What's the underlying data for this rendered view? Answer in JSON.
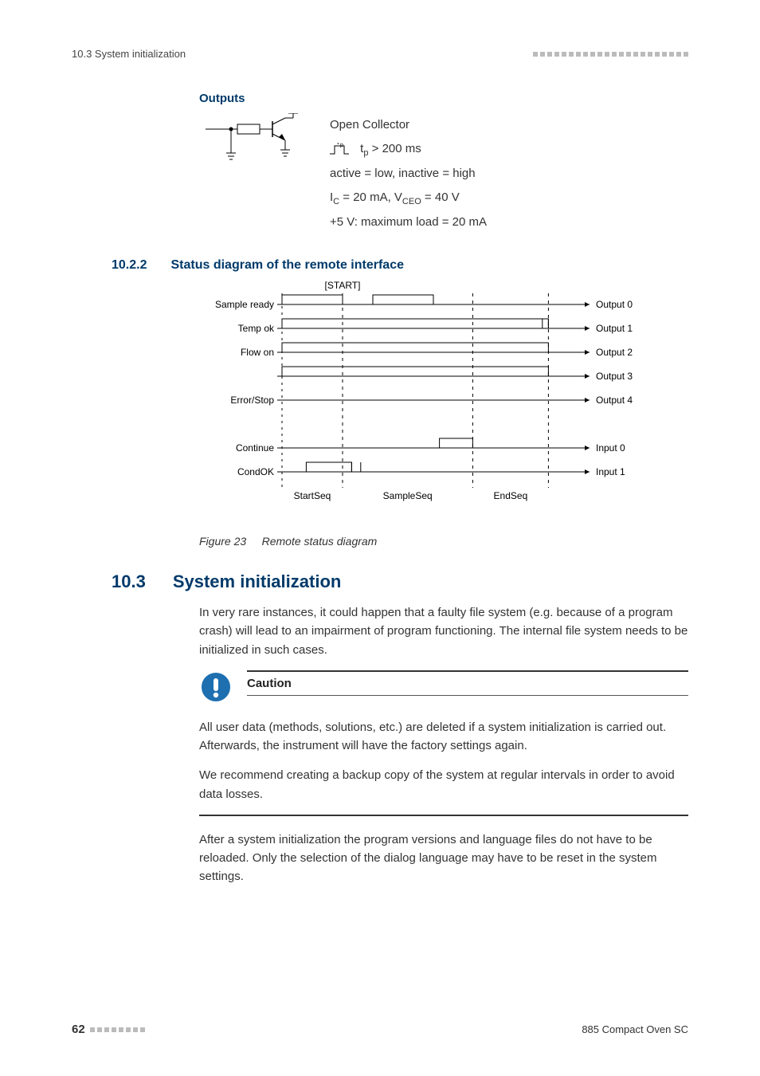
{
  "header": {
    "running": "10.3 System initialization"
  },
  "outputs": {
    "heading": "Outputs",
    "line1": "Open Collector",
    "tp_label": "t",
    "tp_sub": "p",
    "tp_expr": " > 200 ms",
    "active_line": "active = low, inactive = high",
    "ic_line_pre": "I",
    "ic_sub": "C",
    "ic_mid": " = 20 mA, V",
    "vceo_sub": "CEO",
    "ic_post": " = 40 V",
    "last_line": "+5 V: maximum load = 20 mA"
  },
  "sec1022": {
    "num": "10.2.2",
    "title": "Status diagram of the remote interface"
  },
  "chart_data": {
    "type": "timing-diagram",
    "title": "Remote status diagram",
    "phases": [
      "StartSeq",
      "SampleSeq",
      "EndSeq"
    ],
    "phase_bounds": [
      0.0,
      0.2,
      0.63,
      0.88
    ],
    "start_marker": "[START]",
    "rows": [
      {
        "left_label": "Sample ready",
        "right_label": "Output 0",
        "segments": [
          [
            0.0,
            0.2
          ],
          [
            0.3,
            0.5
          ]
        ]
      },
      {
        "left_label": "Temp ok",
        "right_label": "Output 1",
        "segments": [
          [
            0.0,
            0.88
          ]
        ],
        "dip": [
          0.86,
          0.88
        ]
      },
      {
        "left_label": "Flow on",
        "right_label": "Output 2",
        "segments": [
          [
            0.0,
            0.88
          ]
        ]
      },
      {
        "left_label": "",
        "right_label": "Output 3",
        "segments": [
          [
            0.0,
            0.88
          ]
        ]
      },
      {
        "left_label": "Error/Stop",
        "right_label": "Output 4",
        "segments": []
      },
      {
        "spacer": true
      },
      {
        "left_label": "Continue",
        "right_label": "Input 0",
        "segments": [
          [
            0.52,
            0.63
          ]
        ]
      },
      {
        "left_label": "CondOK",
        "right_label": "Input 1",
        "segments": [
          [
            0.08,
            0.23
          ]
        ],
        "dip": [
          0.23,
          0.26
        ]
      }
    ],
    "figure_number": "Figure 23",
    "figure_caption": "Remote status diagram"
  },
  "sec103": {
    "num": "10.3",
    "title": "System initialization",
    "para1": "In very rare instances, it could happen that a faulty file system (e.g. because of a program crash) will lead to an impairment of program functioning. The internal file system needs to be initialized in such cases.",
    "caution_label": "Caution",
    "caution_p1": "All user data (methods, solutions, etc.) are deleted if a system initialization is carried out. Afterwards, the instrument will have the factory settings again.",
    "caution_p2": "We recommend creating a backup copy of the system at regular intervals in order to avoid data losses.",
    "para2": "After a system initialization the program versions and language files do not have to be reloaded. Only the selection of the dialog language may have to be reset in the system settings."
  },
  "footer": {
    "page": "62",
    "product": "885 Compact Oven SC"
  }
}
